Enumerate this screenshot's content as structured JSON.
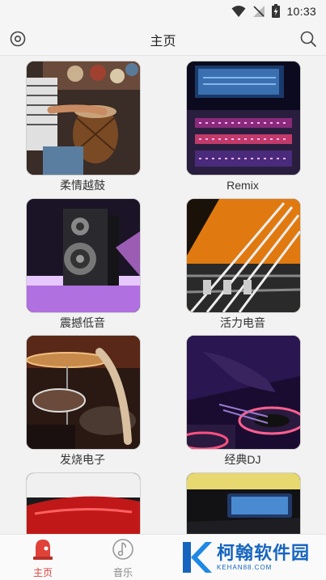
{
  "status": {
    "time": "10:33"
  },
  "app_bar": {
    "title": "主页",
    "left_icon": "target-icon",
    "right_icon": "search-icon"
  },
  "cards": [
    {
      "label": "柔情越鼓",
      "image": "hand-drum-photo"
    },
    {
      "label": "Remix",
      "image": "mixing-console-photo"
    },
    {
      "label": "震撼低音",
      "image": "speaker-photo"
    },
    {
      "label": "活力电音",
      "image": "bass-guitar-strings-photo"
    },
    {
      "label": "发烧电子",
      "image": "drum-kit-photo"
    },
    {
      "label": "经典DJ",
      "image": "dj-turntable-photo"
    },
    {
      "label": "",
      "image": "red-car-photo"
    },
    {
      "label": "",
      "image": "car-dashboard-photo"
    }
  ],
  "bottom_nav": {
    "tabs": [
      {
        "label": "主页",
        "icon": "home-bell-icon",
        "active": true
      },
      {
        "label": "音乐",
        "icon": "music-note-icon",
        "active": false
      }
    ]
  },
  "watermark": {
    "title": "柯翰软件园",
    "subtitle": "KEHAN88.COM",
    "logo_letter": "K"
  },
  "colors": {
    "accent": "#e0423a",
    "watermark": "#1565c0"
  }
}
